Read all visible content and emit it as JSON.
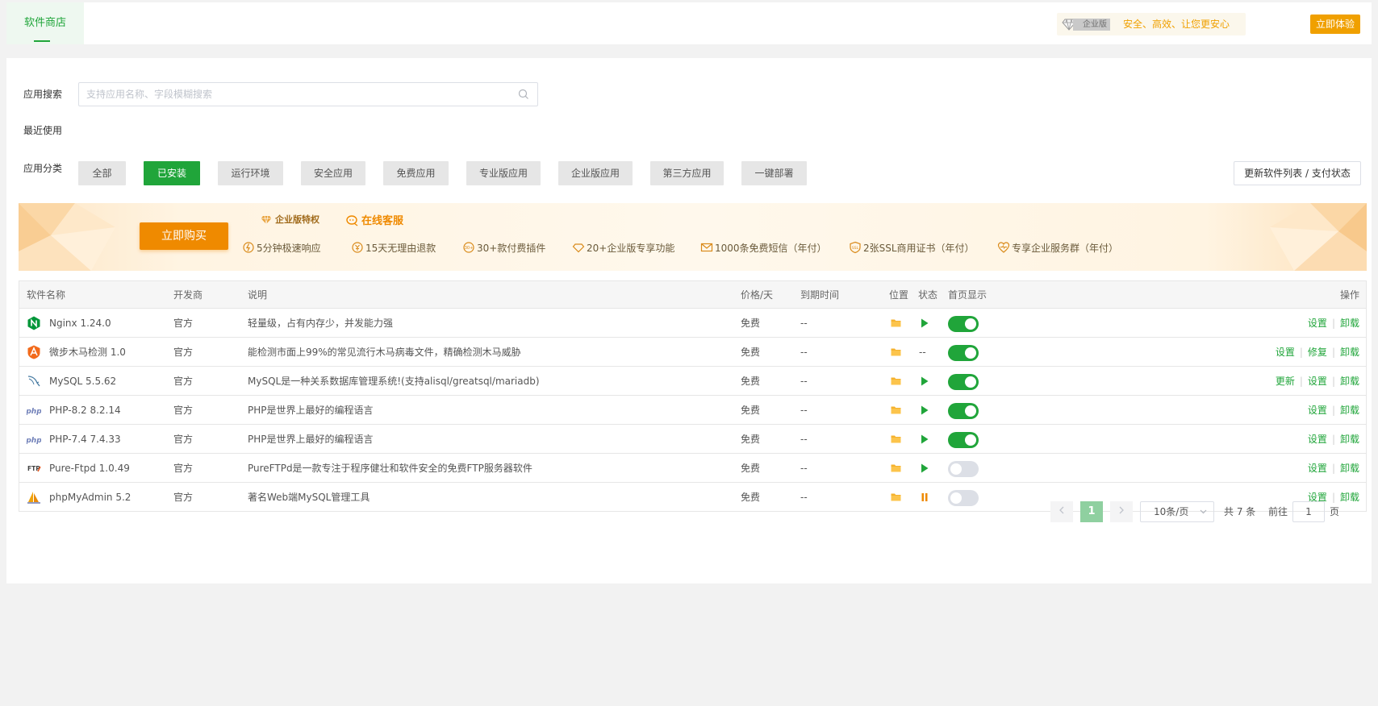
{
  "header": {
    "store_tab": "软件商店",
    "ent_badge": "企业版",
    "ent_slogan": "安全、高效、让您更安心",
    "try_button": "立即体验"
  },
  "search": {
    "label": "应用搜索",
    "placeholder": "支持应用名称、字段模糊搜索"
  },
  "recent": {
    "label": "最近使用"
  },
  "categories": {
    "label": "应用分类",
    "items": [
      "全部",
      "已安装",
      "运行环境",
      "安全应用",
      "免费应用",
      "专业版应用",
      "企业版应用",
      "第三方应用",
      "一键部署"
    ],
    "active": "已安装",
    "update_button": "更新软件列表 / 支付状态"
  },
  "banner": {
    "buy_button": "立即购买",
    "title": "企业版特权",
    "online_service": "在线客服",
    "features": [
      "5分钟极速响应",
      "15天无理由退款",
      "30+款付费插件",
      "20+企业版专享功能",
      "1000条免费短信（年付）",
      "2张SSL商用证书（年付）",
      "专享企业服务群（年付）"
    ]
  },
  "table": {
    "headers": {
      "name": "软件名称",
      "developer": "开发商",
      "description": "说明",
      "price": "价格/天",
      "expiry": "到期时间",
      "location": "位置",
      "status": "状态",
      "homepage": "首页显示",
      "actions": "操作"
    },
    "rows": [
      {
        "name": "Nginx 1.24.0",
        "icon": "nginx-icon",
        "developer": "官方",
        "description": "轻量级，占有内存少，并发能力强",
        "price": "免费",
        "expiry": "--",
        "status": "running",
        "homepage": true,
        "actions": [
          "设置",
          "卸载"
        ]
      },
      {
        "name": "微步木马检测 1.0",
        "icon": "threatbook-icon",
        "developer": "官方",
        "description": "能检测市面上99%的常见流行木马病毒文件，精确检测木马威胁",
        "price": "免费",
        "expiry": "--",
        "status": "--",
        "homepage": true,
        "actions": [
          "设置",
          "修复",
          "卸载"
        ]
      },
      {
        "name": "MySQL 5.5.62",
        "icon": "mysql-icon",
        "developer": "官方",
        "description": "MySQL是一种关系数据库管理系统!(支持alisql/greatsql/mariadb)",
        "price": "免费",
        "expiry": "--",
        "status": "running",
        "homepage": true,
        "actions": [
          "更新",
          "设置",
          "卸载"
        ]
      },
      {
        "name": "PHP-8.2 8.2.14",
        "icon": "php-icon",
        "developer": "官方",
        "description": "PHP是世界上最好的编程语言",
        "price": "免费",
        "expiry": "--",
        "status": "running",
        "homepage": true,
        "actions": [
          "设置",
          "卸载"
        ]
      },
      {
        "name": "PHP-7.4 7.4.33",
        "icon": "php-icon",
        "developer": "官方",
        "description": "PHP是世界上最好的编程语言",
        "price": "免费",
        "expiry": "--",
        "status": "running",
        "homepage": true,
        "actions": [
          "设置",
          "卸载"
        ]
      },
      {
        "name": "Pure-Ftpd 1.0.49",
        "icon": "ftp-icon",
        "developer": "官方",
        "description": "PureFTPd是一款专注于程序健壮和软件安全的免费FTP服务器软件",
        "price": "免费",
        "expiry": "--",
        "status": "running",
        "homepage": false,
        "actions": [
          "设置",
          "卸载"
        ]
      },
      {
        "name": "phpMyAdmin 5.2",
        "icon": "phpmyadmin-icon",
        "developer": "官方",
        "description": "著名Web端MySQL管理工具",
        "price": "免费",
        "expiry": "--",
        "status": "paused",
        "homepage": false,
        "actions": [
          "设置",
          "卸载"
        ]
      }
    ]
  },
  "pagination": {
    "current_page": "1",
    "page_size": "10条/页",
    "total": "共 7 条",
    "goto_label": "前往",
    "goto_value": "1",
    "page_unit": "页"
  },
  "colors": {
    "accent": "#20a53a",
    "orange": "#ef8a00",
    "gold": "#f0a000"
  }
}
